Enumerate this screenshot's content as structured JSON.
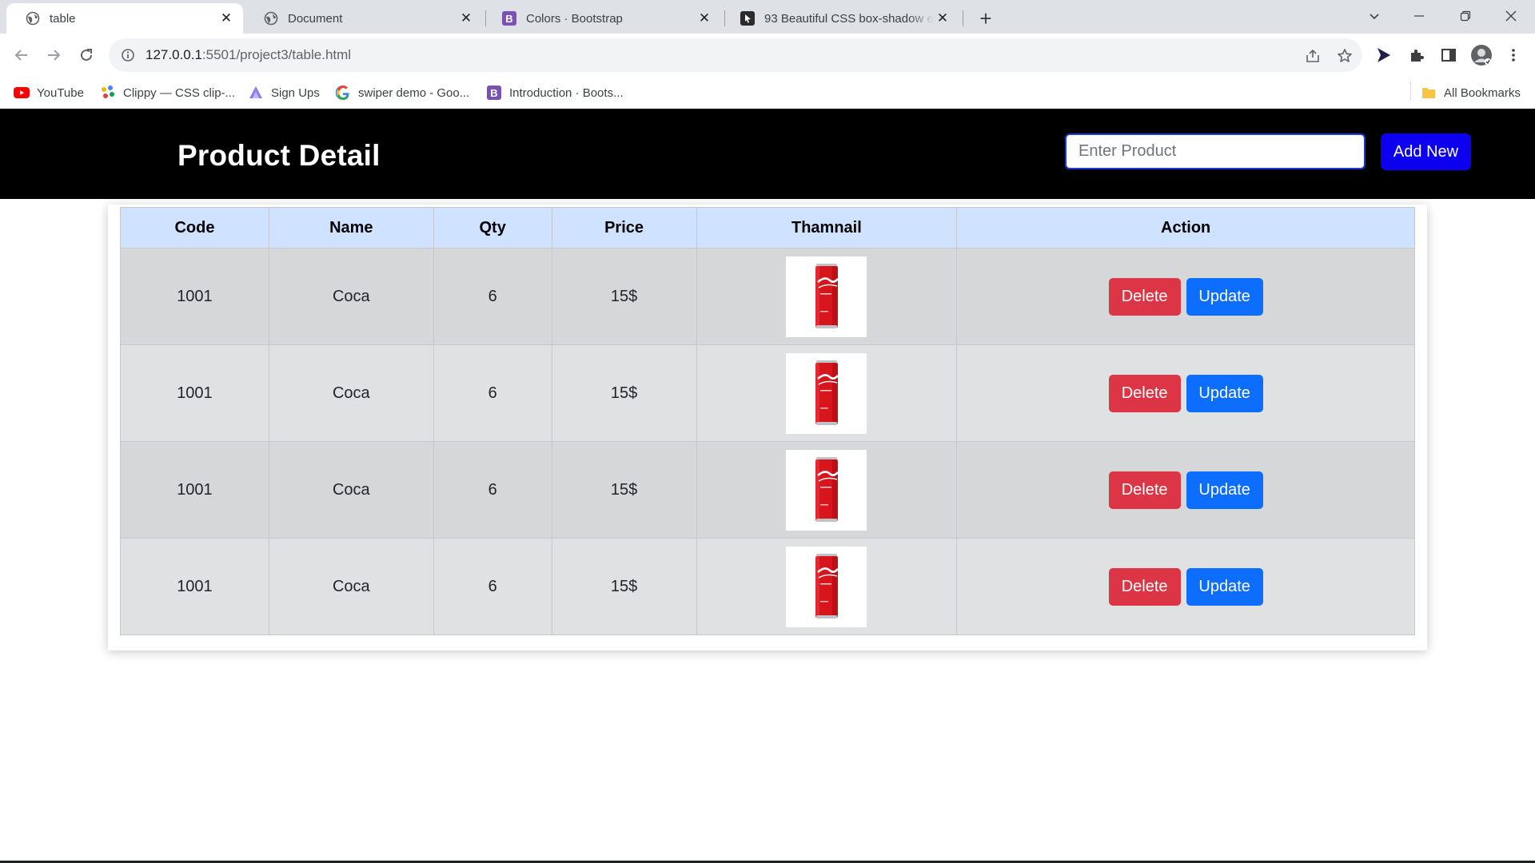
{
  "browser": {
    "tabs": [
      {
        "title": "table",
        "icon": "globe-icon",
        "active": true
      },
      {
        "title": "Document",
        "icon": "globe-icon",
        "active": false
      },
      {
        "title": "Colors · Bootstrap",
        "icon": "bootstrap-icon",
        "active": false
      },
      {
        "title": "93 Beautiful CSS box-shadow ex",
        "icon": "cursor-app-icon",
        "active": false
      }
    ],
    "url": {
      "host": "127.0.0.1",
      "path": ":5501/project3/table.html"
    },
    "bookmarks": [
      {
        "label": "YouTube",
        "icon": "youtube-icon"
      },
      {
        "label": "Clippy — CSS clip-...",
        "icon": "clippy-icon"
      },
      {
        "label": "Sign Ups",
        "icon": "signups-icon"
      },
      {
        "label": "swiper demo - Goo...",
        "icon": "google-icon"
      },
      {
        "label": "Introduction · Boots...",
        "icon": "bootstrap-icon"
      }
    ],
    "all_bookmarks": "All Bookmarks"
  },
  "header": {
    "title": "Product Detail",
    "input_placeholder": "Enter Product",
    "add_label": "Add New"
  },
  "table": {
    "columns": [
      "Code",
      "Name",
      "Qty",
      "Price",
      "Thamnail",
      "Action"
    ],
    "rows": [
      {
        "code": "1001",
        "name": "Coca",
        "qty": "6",
        "price": "15$"
      },
      {
        "code": "1001",
        "name": "Coca",
        "qty": "6",
        "price": "15$"
      },
      {
        "code": "1001",
        "name": "Coca",
        "qty": "6",
        "price": "15$"
      },
      {
        "code": "1001",
        "name": "Coca",
        "qty": "6",
        "price": "15$"
      }
    ],
    "delete_label": "Delete",
    "update_label": "Update"
  },
  "colors": {
    "header_bg": "#000000",
    "add_button": "#0d00f0",
    "table_head": "#cfe2ff",
    "delete_button": "#dc3545",
    "update_button": "#0d6efd"
  }
}
